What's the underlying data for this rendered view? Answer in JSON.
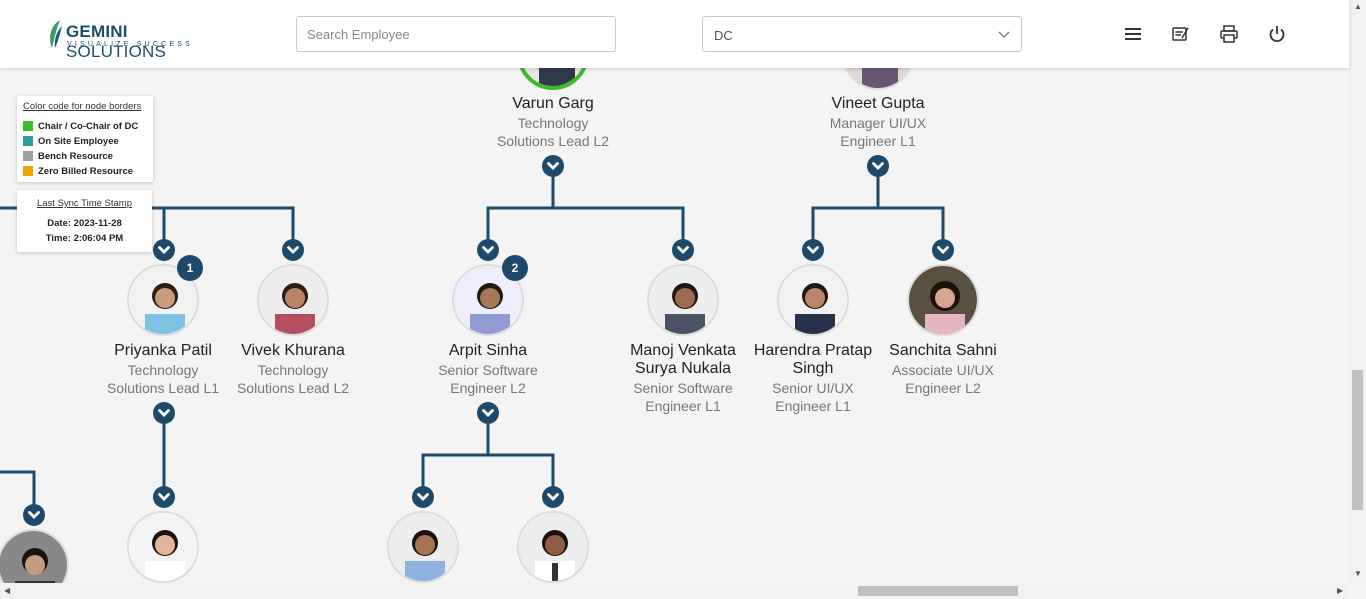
{
  "header": {
    "logo_name": "GEMINI",
    "logo_name2": "SOLUTIONS",
    "logo_tagline": "VISUALIZE SUCCESS",
    "search_placeholder": "Search Employee",
    "dc_select_value": "DC",
    "icons": [
      "menu-icon",
      "notes-icon",
      "printer-icon",
      "power-icon"
    ]
  },
  "legend": {
    "title": "Color code for node borders",
    "items": [
      {
        "label": "Chair / Co-Chair of DC",
        "color": "#3dbb2a"
      },
      {
        "label": "On Site Employee",
        "color": "#2a9e9c"
      },
      {
        "label": "Bench Resource",
        "color": "#9e9e9e"
      },
      {
        "label": "Zero Billed Resource",
        "color": "#f0a500"
      }
    ]
  },
  "sync": {
    "title": "Last Sync Time Stamp",
    "date": "Date: 2023-11-28",
    "time": "Time: 2:06:04 PM"
  },
  "colors": {
    "connector": "#1d4a6b",
    "chair_border": "#3dbb2a"
  },
  "nodes": {
    "varun": {
      "name": "Varun Garg",
      "role1": "Technology",
      "role2": "Solutions Lead L2"
    },
    "vineet": {
      "name": "Vineet Gupta",
      "role1": "Manager UI/UX",
      "role2": "Engineer L1"
    },
    "priyanka": {
      "name": "Priyanka Patil",
      "role1": "Technology",
      "role2": "Solutions Lead L1",
      "badge": "1"
    },
    "vivek": {
      "name": "Vivek Khurana",
      "role1": "Technology",
      "role2": "Solutions Lead L2"
    },
    "arpit": {
      "name": "Arpit Sinha",
      "role1": "Senior Software",
      "role2": "Engineer L2",
      "badge": "2"
    },
    "manoj": {
      "name1": "Manoj Venkata",
      "name2": "Surya Nukala",
      "role1": "Senior Software",
      "role2": "Engineer L1"
    },
    "harendra": {
      "name1": "Harendra Pratap",
      "name2": "Singh",
      "role1": "Senior UI/UX",
      "role2": "Engineer L1"
    },
    "sanchita": {
      "name": "Sanchita Sahni",
      "role1": "Associate UI/UX",
      "role2": "Engineer L2"
    }
  }
}
